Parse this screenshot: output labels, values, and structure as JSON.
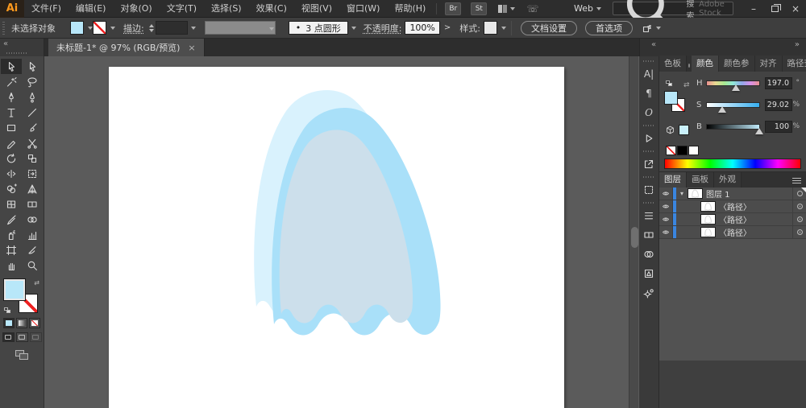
{
  "window": {
    "minimize": "–",
    "close": "×"
  },
  "menu": {
    "logo": "Ai",
    "items": [
      "文件(F)",
      "编辑(E)",
      "对象(O)",
      "文字(T)",
      "选择(S)",
      "效果(C)",
      "视图(V)",
      "窗口(W)",
      "帮助(H)"
    ],
    "br_label": "Br",
    "st_label": "St",
    "web_label": "Web",
    "search_label": "搜索",
    "search_brand": "Adobe Stock"
  },
  "control_bar": {
    "status": "未选择对象",
    "stroke_label": "描边:",
    "brush_dot": "•",
    "brush_value": "3 点圆形",
    "opacity_label": "不透明度:",
    "opacity_value": "100%",
    "more_arrow": ">",
    "style_label": "样式:",
    "doc_setup_btn": "文档设置",
    "preferences_btn": "首选项"
  },
  "tab_bar": {
    "collapse_icon": "«",
    "expand_icon": "»",
    "tab_title": "未标题-1* @ 97% (RGB/预览)",
    "close_icon": "×"
  },
  "toolbar": {
    "tools": [
      {
        "icon": "selection",
        "active": true
      },
      {
        "icon": "direct-selection",
        "active": false
      },
      {
        "icon": "magic-wand",
        "active": false
      },
      {
        "icon": "lasso",
        "active": false
      },
      {
        "icon": "pen",
        "active": false
      },
      {
        "icon": "curvature",
        "active": false
      },
      {
        "icon": "type",
        "active": false
      },
      {
        "icon": "line",
        "active": false
      },
      {
        "icon": "rectangle",
        "active": false
      },
      {
        "icon": "paintbrush",
        "active": false
      },
      {
        "icon": "shaper",
        "active": false
      },
      {
        "icon": "scissors",
        "active": false
      },
      {
        "icon": "rotate",
        "active": false
      },
      {
        "icon": "scale",
        "active": false
      },
      {
        "icon": "width",
        "active": false
      },
      {
        "icon": "free-transform",
        "active": false
      },
      {
        "icon": "shape-builder",
        "active": false
      },
      {
        "icon": "perspective-grid",
        "active": false
      },
      {
        "icon": "mesh",
        "active": false
      },
      {
        "icon": "gradient",
        "active": false
      },
      {
        "icon": "eyedropper",
        "active": false
      },
      {
        "icon": "blend",
        "active": false
      },
      {
        "icon": "symbol-sprayer",
        "active": false
      },
      {
        "icon": "graph",
        "active": false
      },
      {
        "icon": "artboard",
        "active": false
      },
      {
        "icon": "slice",
        "active": false
      },
      {
        "icon": "hand",
        "active": false
      },
      {
        "icon": "zoom",
        "active": false
      }
    ]
  },
  "dock": {
    "items": [
      {
        "name": "character-panel",
        "glyph": "A|"
      },
      {
        "name": "paragraph-panel",
        "glyph": "¶"
      },
      {
        "name": "opentype-panel",
        "glyph": "O"
      },
      {
        "name": "actions-panel",
        "icon": "play"
      },
      {
        "name": "export-panel",
        "icon": "export"
      },
      {
        "name": "transform-panel",
        "icon": "transform-grid"
      },
      {
        "name": "stroke-panel",
        "icon": "stroke3"
      },
      {
        "name": "gradient-panel",
        "icon": "gradient"
      },
      {
        "name": "transparency-panel",
        "icon": "transparency"
      },
      {
        "name": "symbols-panel",
        "icon": "symbols"
      },
      {
        "name": "asset-export-panel",
        "icon": "gears"
      }
    ]
  },
  "panels": {
    "color": {
      "tabs": [
        "色板",
        "颜色",
        "颜色参",
        "对齐",
        "路径查"
      ],
      "active_tab": "颜色",
      "sliders": [
        {
          "label": "H",
          "value": "197.0",
          "unit": "°",
          "max": 360,
          "num": 197
        },
        {
          "label": "S",
          "value": "29.02",
          "unit": "%",
          "max": 100,
          "num": 29
        },
        {
          "label": "B",
          "value": "100",
          "unit": "%",
          "max": 100,
          "num": 100
        }
      ]
    },
    "layers": {
      "tabs": [
        "图层",
        "画板",
        "外观"
      ],
      "active_tab": "图层",
      "rows": [
        {
          "kind": "layer",
          "name": "图层 1",
          "expanded": true
        },
        {
          "kind": "path",
          "name": "〈路径〉"
        },
        {
          "kind": "path",
          "name": "〈路径〉"
        },
        {
          "kind": "path",
          "name": "〈路径〉"
        }
      ]
    }
  },
  "colors": {
    "fill": "#b8e7f9",
    "ghost_back": "#d9f2fd",
    "ghost_mid": "#a9e0f9",
    "ghost_front": "#ccdfeb",
    "selection_blue": "#3a86e0"
  }
}
